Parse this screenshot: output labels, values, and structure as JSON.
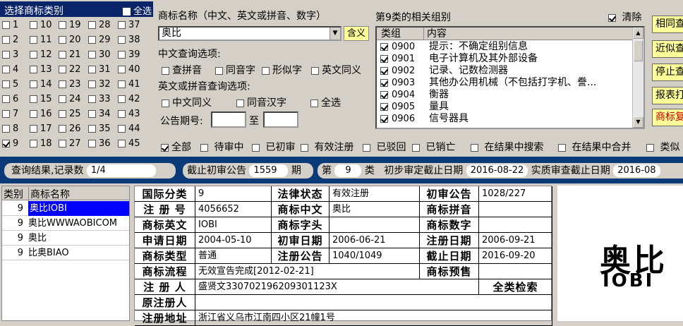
{
  "category_panel": {
    "title": "选择商标类别",
    "select_all_label": "全选",
    "columns": [
      [
        "1",
        "2",
        "3",
        "4",
        "5",
        "6",
        "7",
        "8",
        "9"
      ],
      [
        "10",
        "11",
        "12",
        "13",
        "14",
        "15",
        "16",
        "17",
        "18"
      ],
      [
        "19",
        "20",
        "21",
        "22",
        "23",
        "24",
        "25",
        "26",
        "27"
      ],
      [
        "28",
        "29",
        "30",
        "31",
        "32",
        "33",
        "34",
        "35",
        "36"
      ],
      [
        "37",
        "38",
        "39",
        "40",
        "41",
        "42",
        "43",
        "44",
        "45"
      ]
    ],
    "checked": [
      "9"
    ]
  },
  "name_query": {
    "label": "商标名称（中文、英文或拼音、数字）",
    "value": "奥比",
    "meaning_button": "含义",
    "cn_options_label": "中文查询选项:",
    "cn_options": [
      "查拼音",
      "同音字",
      "形似字",
      "英文同义"
    ],
    "en_options_label": "英文或拼音查询选项:",
    "en_options": [
      "中文同义",
      "同音汉字",
      "全选"
    ],
    "announce_label": "公告期号:",
    "announce_to": "至"
  },
  "groups": {
    "title": "第9类的相关组别",
    "clear_label": "清除",
    "header_group": "类组",
    "header_content": "内容",
    "rows": [
      {
        "code": "0900",
        "desc": "提示：不确定组别信息"
      },
      {
        "code": "0901",
        "desc": "电子计算机及其外部设备"
      },
      {
        "code": "0902",
        "desc": "记录、记数检测器"
      },
      {
        "code": "0903",
        "desc": "其他办公用机械（不包括打字机、誊..."
      },
      {
        "code": "0904",
        "desc": "衡器"
      },
      {
        "code": "0905",
        "desc": "量具"
      },
      {
        "code": "0906",
        "desc": "信号器具"
      }
    ]
  },
  "right_buttons": [
    "相同查",
    "近似查",
    "停止查",
    "报表打",
    "商标复"
  ],
  "status_filters": [
    "全部",
    "待审中",
    "已初审",
    "有效注册",
    "已驳回",
    "已销亡",
    "在结果中搜索",
    "在结果中合并",
    "类似"
  ],
  "info_bar": {
    "results_label": "查询结果,记录数",
    "results_value": "1/4",
    "deadline_label": "截止初审公告",
    "deadline_value": "1559",
    "deadline_unit": "期",
    "class_prefix": "第",
    "class_value": "9",
    "class_suffix": "类",
    "prelim_label": "初步审定截止日期",
    "prelim_date": "2016-08-22",
    "exam_label": "实质审查截止日期",
    "exam_date": "2016-08"
  },
  "results": {
    "header_class": "类别",
    "header_name": "商标名称",
    "rows": [
      {
        "cls": "9",
        "name": "奥比IOBI"
      },
      {
        "cls": "9",
        "name": "奥比WWWAOBICOM"
      },
      {
        "cls": "9",
        "name": "奥比"
      },
      {
        "cls": "9",
        "name": "比奥BIAO"
      }
    ]
  },
  "detail": {
    "intl_class_label": "国际分类",
    "intl_class": "9",
    "legal_status_label": "法律状态",
    "legal_status": "有效注册",
    "prelim_pub_label": "初审公告",
    "prelim_pub": "1028/227",
    "reg_no_label": "注 册 号",
    "reg_no": "4056652",
    "name_cn_label": "商标中文",
    "name_cn": "奥比",
    "pinyin_label": "商标拼音",
    "pinyin": "",
    "name_en_label": "商标英文",
    "name_en": "IOBI",
    "initials_label": "商标字头",
    "initials": "",
    "digits_label": "商标数字",
    "digits": "",
    "apply_date_label": "申请日期",
    "apply_date": "2004-05-10",
    "prelim_date_label": "初审日期",
    "prelim_date": "2006-06-21",
    "reg_date_label": "注册日期",
    "reg_date": "2006-09-21",
    "type_label": "商标类型",
    "type": "普通",
    "reg_pub_label": "注册公告",
    "reg_pub": "1040/1049",
    "expiry_label": "截止日期",
    "expiry": "2016-09-20",
    "flow_label": "商标流程",
    "flow": "无效宣告完成[2012-02-21]",
    "preview_label": "商标预售",
    "registrant_label": "注 册 人",
    "registrant": "盛贤文330702196209301123X",
    "all_class_search": "全类检索",
    "orig_registrant_label": "原注册人",
    "orig_registrant": "",
    "address_label": "注册地址",
    "address": "浙江省义乌市江南四小区21幢1号"
  },
  "logo": {
    "cn": "奥比",
    "en": "IOBI"
  }
}
